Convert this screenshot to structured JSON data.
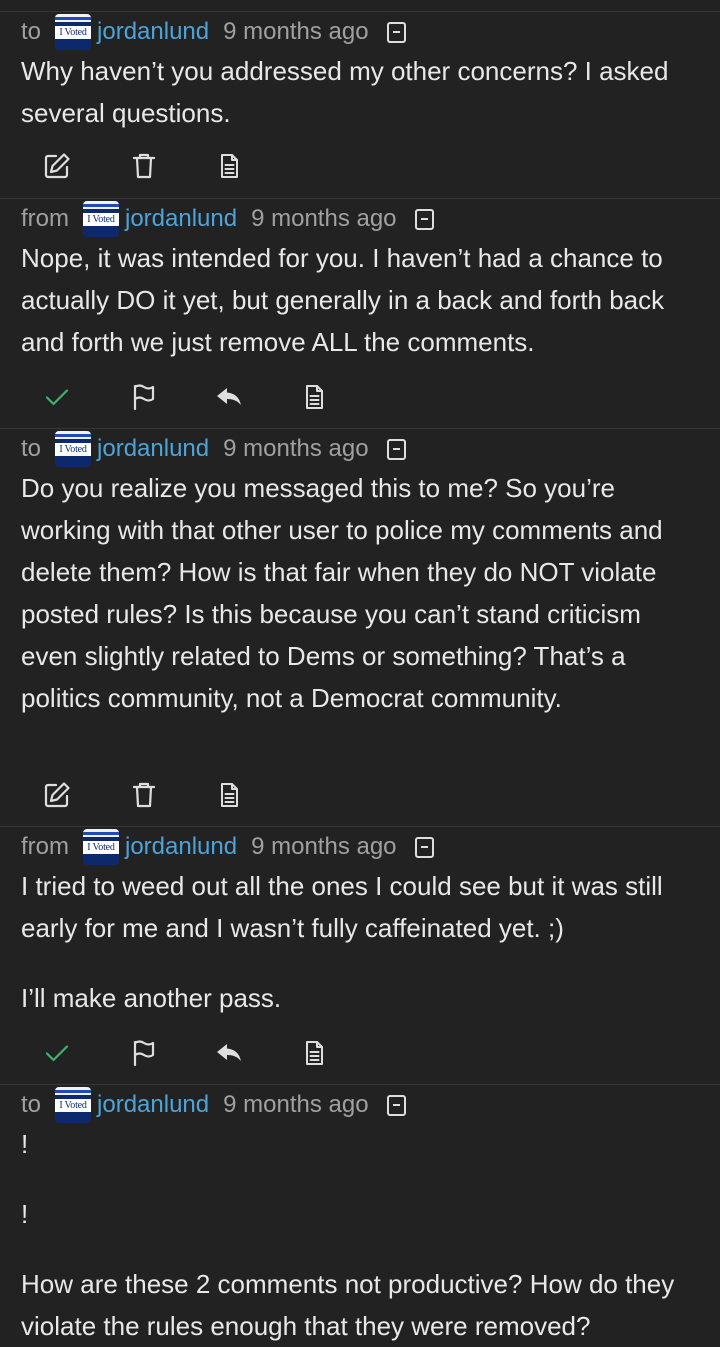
{
  "messages": [
    {
      "direction": "to",
      "badge": "I Voted",
      "username": "jordanlund",
      "time": "9 months ago",
      "paragraphs": [
        "Why haven’t you addressed my other concerns? I asked several questions."
      ],
      "actions": [
        "edit-icon",
        "trash-icon",
        "view-source-icon"
      ]
    },
    {
      "direction": "from",
      "badge": "I Voted",
      "username": "jordanlund",
      "time": "9 months ago",
      "paragraphs": [
        "Nope, it was intended for you. I haven’t had a chance to actually DO it yet, but generally in a back and forth back and forth we just remove ALL the comments."
      ],
      "actions": [
        "mark-read-check-icon",
        "report-flag-icon",
        "reply-icon",
        "view-source-icon"
      ]
    },
    {
      "direction": "to",
      "badge": "I Voted",
      "username": "jordanlund",
      "time": "9 months ago",
      "paragraphs": [
        "Do you realize you messaged this to me? So you’re working with that other user to police my comments and delete them? How is that fair when they do NOT violate posted rules? Is this because you can’t stand criticism even slightly related to Dems or something? That’s a politics community, not a Democrat community."
      ],
      "actions": [
        "edit-icon",
        "trash-icon",
        "view-source-icon"
      ]
    },
    {
      "direction": "from",
      "badge": "I Voted",
      "username": "jordanlund",
      "time": "9 months ago",
      "paragraphs": [
        "I tried to weed out all the ones I could see but it was still early for me and I wasn’t fully caffeinated yet. ;)",
        "I’ll make another pass."
      ],
      "actions": [
        "mark-read-check-icon",
        "report-flag-icon",
        "reply-icon",
        "view-source-icon"
      ]
    },
    {
      "direction": "to",
      "badge": "I Voted",
      "username": "jordanlund",
      "time": "9 months ago",
      "paragraphs": [
        "!",
        "!",
        "How are these 2 comments not productive? How do they violate the rules enough that they were removed?"
      ],
      "actions": []
    }
  ],
  "colors": {
    "background": "#222222",
    "username": "#4ea3d9",
    "muted": "#a0a0a0",
    "check": "#3bb371"
  }
}
